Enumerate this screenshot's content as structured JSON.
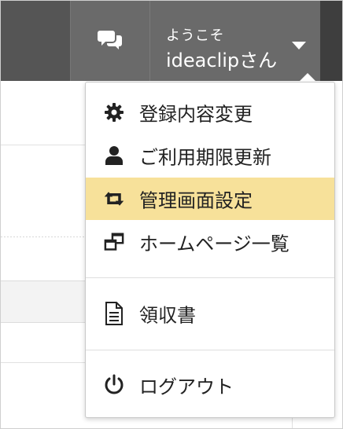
{
  "header": {
    "welcome": "ようこそ",
    "username": "ideaclipさん"
  },
  "menu": {
    "items": [
      {
        "label": "登録内容変更",
        "icon": "gear-icon"
      },
      {
        "label": "ご利用期限更新",
        "icon": "user-icon"
      },
      {
        "label": "管理画面設定",
        "icon": "swap-icon",
        "active": true
      },
      {
        "label": "ホームページ一覧",
        "icon": "window-restore-icon"
      },
      {
        "label": "領収書",
        "icon": "document-icon"
      },
      {
        "label": "ログアウト",
        "icon": "power-icon"
      }
    ]
  },
  "colors": {
    "topbar": "#555555",
    "button": "#6a6a6a",
    "highlight": "#f7e19a"
  }
}
